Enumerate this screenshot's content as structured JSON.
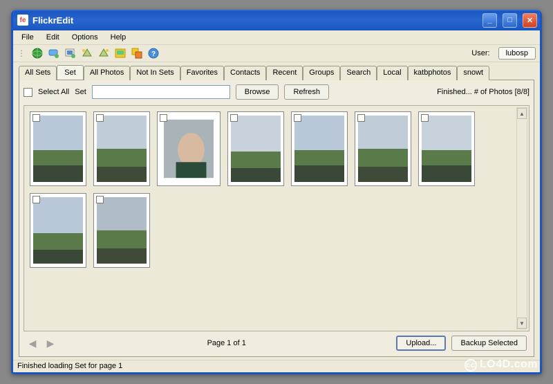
{
  "window": {
    "title": "FlickrEdit",
    "app_icon_text": "fe"
  },
  "menubar": {
    "items": [
      "File",
      "Edit",
      "Options",
      "Help"
    ]
  },
  "toolbar": {
    "user_label": "User:",
    "user_value": "lubosp",
    "icons": [
      "globe-icon",
      "chat-icon",
      "image-icon",
      "rotate-left-icon",
      "rotate-right-icon",
      "picture-icon",
      "copy-icon",
      "help-icon"
    ]
  },
  "tabs": {
    "items": [
      "All Sets",
      "Set",
      "All Photos",
      "Not In Sets",
      "Favorites",
      "Contacts",
      "Recent",
      "Groups",
      "Search",
      "Local",
      "katbphotos",
      "snowt"
    ],
    "active_index": 1
  },
  "controls": {
    "select_all_label": "Select All",
    "set_label": "Set",
    "set_value": "",
    "browse_label": "Browse",
    "refresh_label": "Refresh",
    "status_right": "Finished... # of Photos [8/8]"
  },
  "thumbnails": {
    "count": 9,
    "checked": []
  },
  "pager": {
    "label": "Page 1 of 1",
    "upload_label": "Upload...",
    "backup_label": "Backup Selected"
  },
  "statusbar": {
    "text": "Finished loading Set for page 1"
  },
  "watermark": "LO4D.com"
}
